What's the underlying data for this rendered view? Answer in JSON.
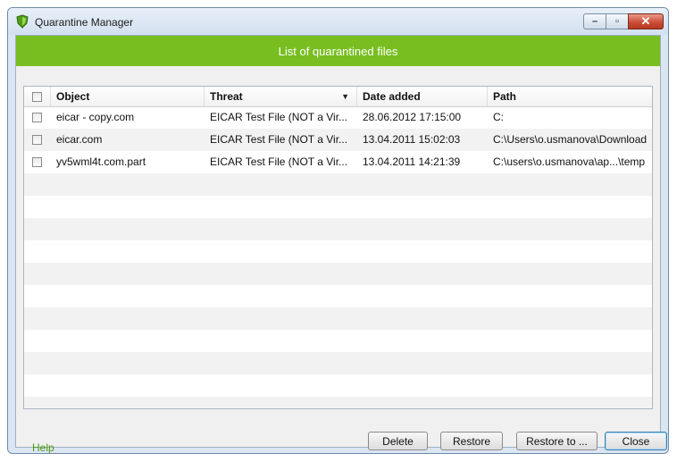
{
  "window": {
    "title": "Quarantine Manager",
    "close_glyph": "✕",
    "minimize_glyph": "–",
    "maximize_glyph": "▫"
  },
  "banner": {
    "text": "List of quarantined files",
    "color": "#78be21"
  },
  "table": {
    "columns": [
      "Object",
      "Threat",
      "Date added",
      "Path"
    ],
    "sort_indicator": "▼",
    "rows": [
      {
        "object": "eicar - copy.com",
        "threat": "EICAR Test File (NOT a Vir...",
        "date": "28.06.2012 17:15:00",
        "path": "C:"
      },
      {
        "object": "eicar.com",
        "threat": "EICAR Test File (NOT a Vir...",
        "date": "13.04.2011 15:02:03",
        "path": "C:\\Users\\o.usmanova\\Download"
      },
      {
        "object": "yv5wml4t.com.part",
        "threat": "EICAR Test File (NOT a Vir...",
        "date": "13.04.2011 14:21:39",
        "path": "C:\\users\\o.usmanova\\ap...\\temp"
      }
    ]
  },
  "footer": {
    "help": "Help",
    "delete": "Delete",
    "restore": "Restore",
    "restore_to": "Restore to ...",
    "close": "Close"
  }
}
